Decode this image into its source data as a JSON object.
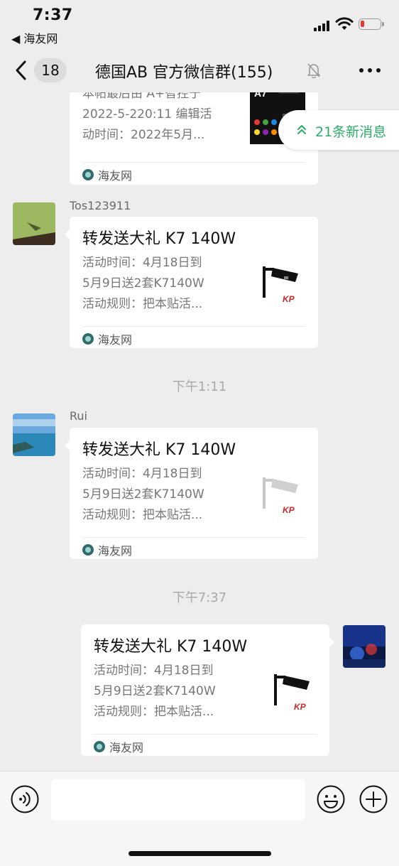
{
  "status_bar": {
    "time": "7:37",
    "back_app": "◀ 海友网",
    "icons": [
      "signal-icon",
      "wifi-icon",
      "battery-icon"
    ],
    "battery_color": "#e53935"
  },
  "nav": {
    "unread_count": "18",
    "title": "德国AB  官方微信群(155)",
    "icons": [
      "back-chevron-icon",
      "mute-bell-icon",
      "more-icon"
    ]
  },
  "new_messages_pill": {
    "label": "21条新消息",
    "color": "#2aae67"
  },
  "messages": [
    {
      "type": "link-card",
      "sender": "",
      "desc_lines": [
        "本帖最后由 A+智控于",
        "2022-5-220:11 编辑活",
        "动时间：2022年5月..."
      ],
      "source": "海友网"
    },
    {
      "type": "link-card",
      "sender": "Tos123911",
      "title": "转发送大礼 K7 140W",
      "desc_lines": [
        "活动时间：4月18日到",
        "5月9日送2套K7140W",
        "活动规则：把本贴活..."
      ],
      "source": "海友网"
    },
    {
      "type": "timestamp",
      "text": "下午1:11"
    },
    {
      "type": "link-card",
      "sender": "Rui",
      "title": "转发送大礼 K7 140W",
      "desc_lines": [
        "活动时间：4月18日到",
        "5月9日送2套K7140W",
        "活动规则：把本贴活..."
      ],
      "source": "海友网"
    },
    {
      "type": "timestamp",
      "text": "下午7:37"
    },
    {
      "type": "link-card",
      "sender": "",
      "outgoing": true,
      "title": "转发送大礼 K7 140W",
      "desc_lines": [
        "活动时间：4月18日到",
        "5月9日送2套K7140W",
        "活动规则：把本贴活..."
      ],
      "source": "海友网"
    }
  ],
  "input_bar": {
    "placeholder": "",
    "icons": [
      "voice-icon",
      "emoji-icon",
      "plus-icon"
    ]
  }
}
